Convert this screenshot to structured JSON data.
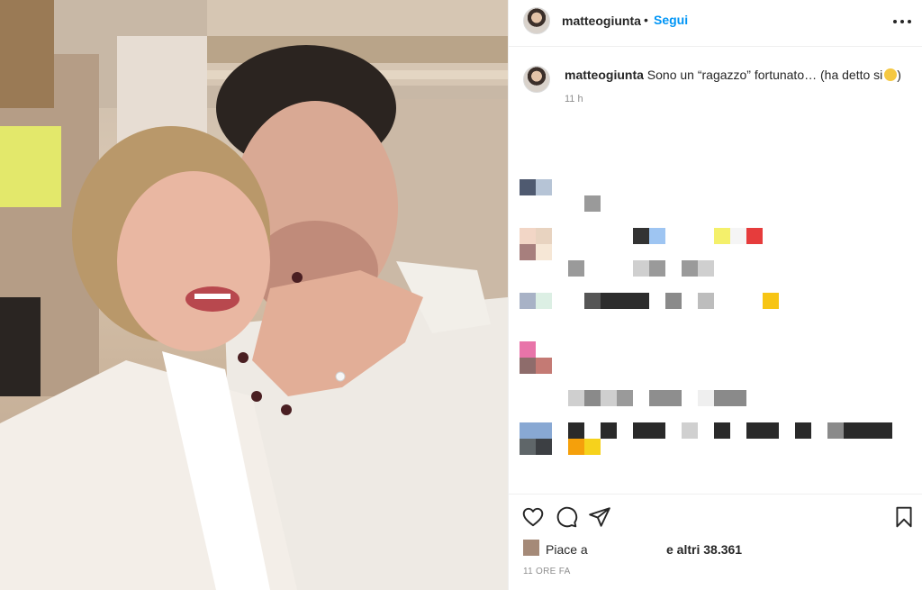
{
  "post": {
    "username": "matteogiunta",
    "separator": "•",
    "follow_label": "Segui",
    "more_icon": "more-options-icon"
  },
  "caption": {
    "username": "matteogiunta",
    "text": "Sono un “ragazzo” fortunato… (ha detto si",
    "text_after_emoji": ")",
    "emoji": "grinning-emoji",
    "time": "11 h"
  },
  "actions": {
    "like_icon": "heart-icon",
    "comment_icon": "comment-icon",
    "share_icon": "share-icon",
    "save_icon": "bookmark-icon"
  },
  "likes": {
    "label": "Piace a",
    "others": "e altri 38.361"
  },
  "post_time": "11 ORE FA",
  "colors": {
    "link": "#0095f6",
    "text": "#262626",
    "muted": "#8e8e8e",
    "divider": "#efefef"
  }
}
